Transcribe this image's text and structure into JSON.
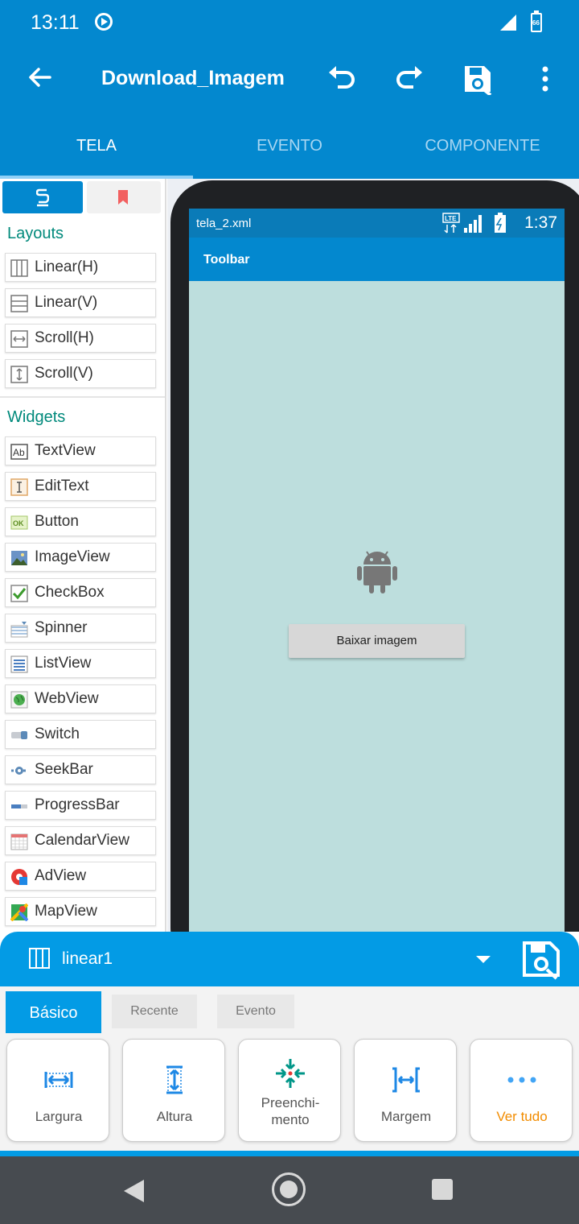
{
  "status_bar": {
    "time": "13:11",
    "battery_level": "66"
  },
  "app_bar": {
    "title": "Download_Imagem"
  },
  "main_tabs": [
    {
      "label": "TELA",
      "active": true
    },
    {
      "label": "EVENTO",
      "active": false
    },
    {
      "label": "COMPONENTE",
      "active": false
    }
  ],
  "palette": {
    "layouts_title": "Layouts",
    "layouts": [
      {
        "label": "Linear(H)",
        "icon": "linear-horizontal-icon"
      },
      {
        "label": "Linear(V)",
        "icon": "linear-vertical-icon"
      },
      {
        "label": "Scroll(H)",
        "icon": "scroll-horizontal-icon"
      },
      {
        "label": "Scroll(V)",
        "icon": "scroll-vertical-icon"
      }
    ],
    "widgets_title": "Widgets",
    "widgets": [
      {
        "label": "TextView",
        "icon": "textview-icon"
      },
      {
        "label": "EditText",
        "icon": "edittext-icon"
      },
      {
        "label": "Button",
        "icon": "button-icon"
      },
      {
        "label": "ImageView",
        "icon": "imageview-icon"
      },
      {
        "label": "CheckBox",
        "icon": "checkbox-icon"
      },
      {
        "label": "Spinner",
        "icon": "spinner-icon"
      },
      {
        "label": "ListView",
        "icon": "listview-icon"
      },
      {
        "label": "WebView",
        "icon": "webview-icon"
      },
      {
        "label": "Switch",
        "icon": "switch-icon"
      },
      {
        "label": "SeekBar",
        "icon": "seekbar-icon"
      },
      {
        "label": "ProgressBar",
        "icon": "progressbar-icon"
      },
      {
        "label": "CalendarView",
        "icon": "calendarview-icon"
      },
      {
        "label": "AdView",
        "icon": "adview-icon"
      },
      {
        "label": "MapView",
        "icon": "mapview-icon"
      }
    ]
  },
  "preview": {
    "file_name": "tela_2.xml",
    "clock": "1:37",
    "network": "LTE",
    "toolbar_title": "Toolbar",
    "button_label": "Baixar imagem"
  },
  "properties": {
    "selected_view": "linear1",
    "tabs": [
      {
        "label": "Básico",
        "active": true
      },
      {
        "label": "Recente",
        "active": false
      },
      {
        "label": "Evento",
        "active": false
      }
    ],
    "cards": [
      {
        "label": "Largura",
        "icon": "width-icon"
      },
      {
        "label": "Altura",
        "icon": "height-icon"
      },
      {
        "label": "Preenchi-\nmento",
        "icon": "padding-icon"
      },
      {
        "label": "Margem",
        "icon": "margin-icon"
      },
      {
        "label": "Ver tudo",
        "icon": "more-dots-icon"
      }
    ]
  },
  "colors": {
    "primary": "#0388cf",
    "accent": "#039be5",
    "section_title": "#00897b",
    "preview_background": "#bddedd",
    "more_label": "#f28c00"
  }
}
